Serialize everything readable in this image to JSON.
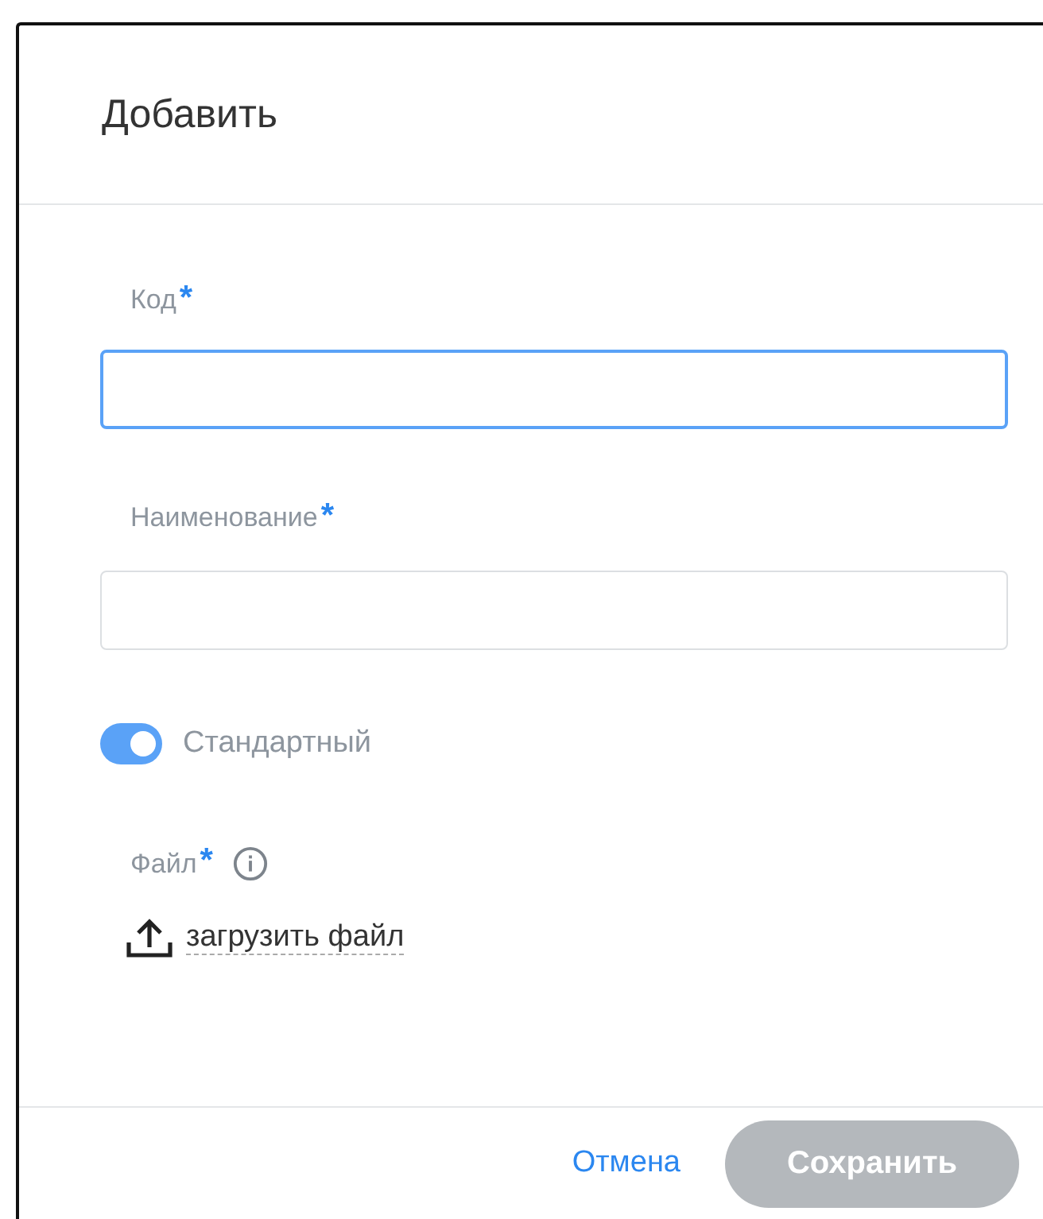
{
  "dialog": {
    "title": "Добавить"
  },
  "fields": [
    {
      "label": "Код",
      "required_mark": "*",
      "focused": true
    },
    {
      "label": "Наименование",
      "required_mark": "*",
      "focused": false
    }
  ],
  "toggle": {
    "label": "Стандартный",
    "on": true
  },
  "file": {
    "label": "Файл",
    "required_mark": "*",
    "upload_link": "загрузить файл"
  },
  "buttons": [
    {
      "kind": "link",
      "label": "Отмена",
      "disabled": false
    },
    {
      "kind": "primary",
      "label": "Сохранить",
      "disabled": true
    }
  ]
}
